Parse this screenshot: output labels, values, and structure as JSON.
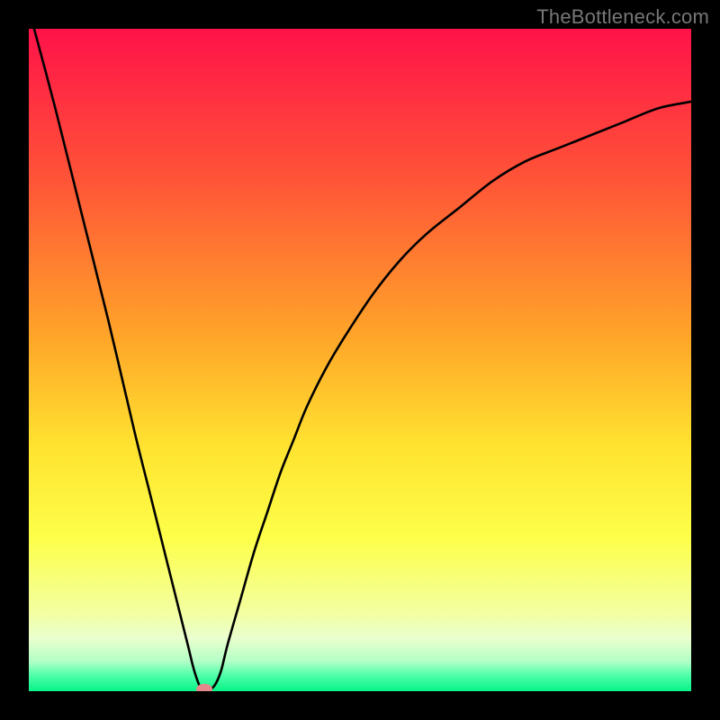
{
  "watermark": "TheBottleneck.com",
  "chart_data": {
    "type": "line",
    "title": "",
    "xlabel": "",
    "ylabel": "",
    "xlim": [
      0,
      100
    ],
    "ylim": [
      0,
      100
    ],
    "grid": false,
    "legend": false,
    "series": [
      {
        "name": "curve",
        "x": [
          0,
          4,
          8,
          12,
          16,
          18,
          20,
          22,
          24,
          25,
          26,
          27,
          28,
          29,
          30,
          32,
          34,
          36,
          38,
          40,
          42,
          45,
          48,
          52,
          56,
          60,
          65,
          70,
          75,
          80,
          85,
          90,
          95,
          100
        ],
        "y": [
          103,
          88,
          72,
          56,
          39,
          31,
          23,
          15,
          7,
          3,
          0.4,
          0.2,
          0.8,
          3,
          7,
          14,
          21,
          27,
          33,
          38,
          43,
          49,
          54,
          60,
          65,
          69,
          73,
          77,
          80,
          82,
          84,
          86,
          88,
          89
        ]
      }
    ],
    "marker": {
      "x": 26.5,
      "y": 0.3,
      "shape": "ellipse",
      "color": "#e4888c"
    },
    "gradient_stops": [
      {
        "offset": 0.0,
        "color": "#ff1249"
      },
      {
        "offset": 0.23,
        "color": "#ff5537"
      },
      {
        "offset": 0.47,
        "color": "#ffa729"
      },
      {
        "offset": 0.63,
        "color": "#ffe330"
      },
      {
        "offset": 0.77,
        "color": "#fdff4a"
      },
      {
        "offset": 0.88,
        "color": "#f3ffa0"
      },
      {
        "offset": 0.92,
        "color": "#eaffce"
      },
      {
        "offset": 0.955,
        "color": "#b2ffc6"
      },
      {
        "offset": 0.975,
        "color": "#52ffab"
      },
      {
        "offset": 1.0,
        "color": "#07f387"
      }
    ]
  }
}
